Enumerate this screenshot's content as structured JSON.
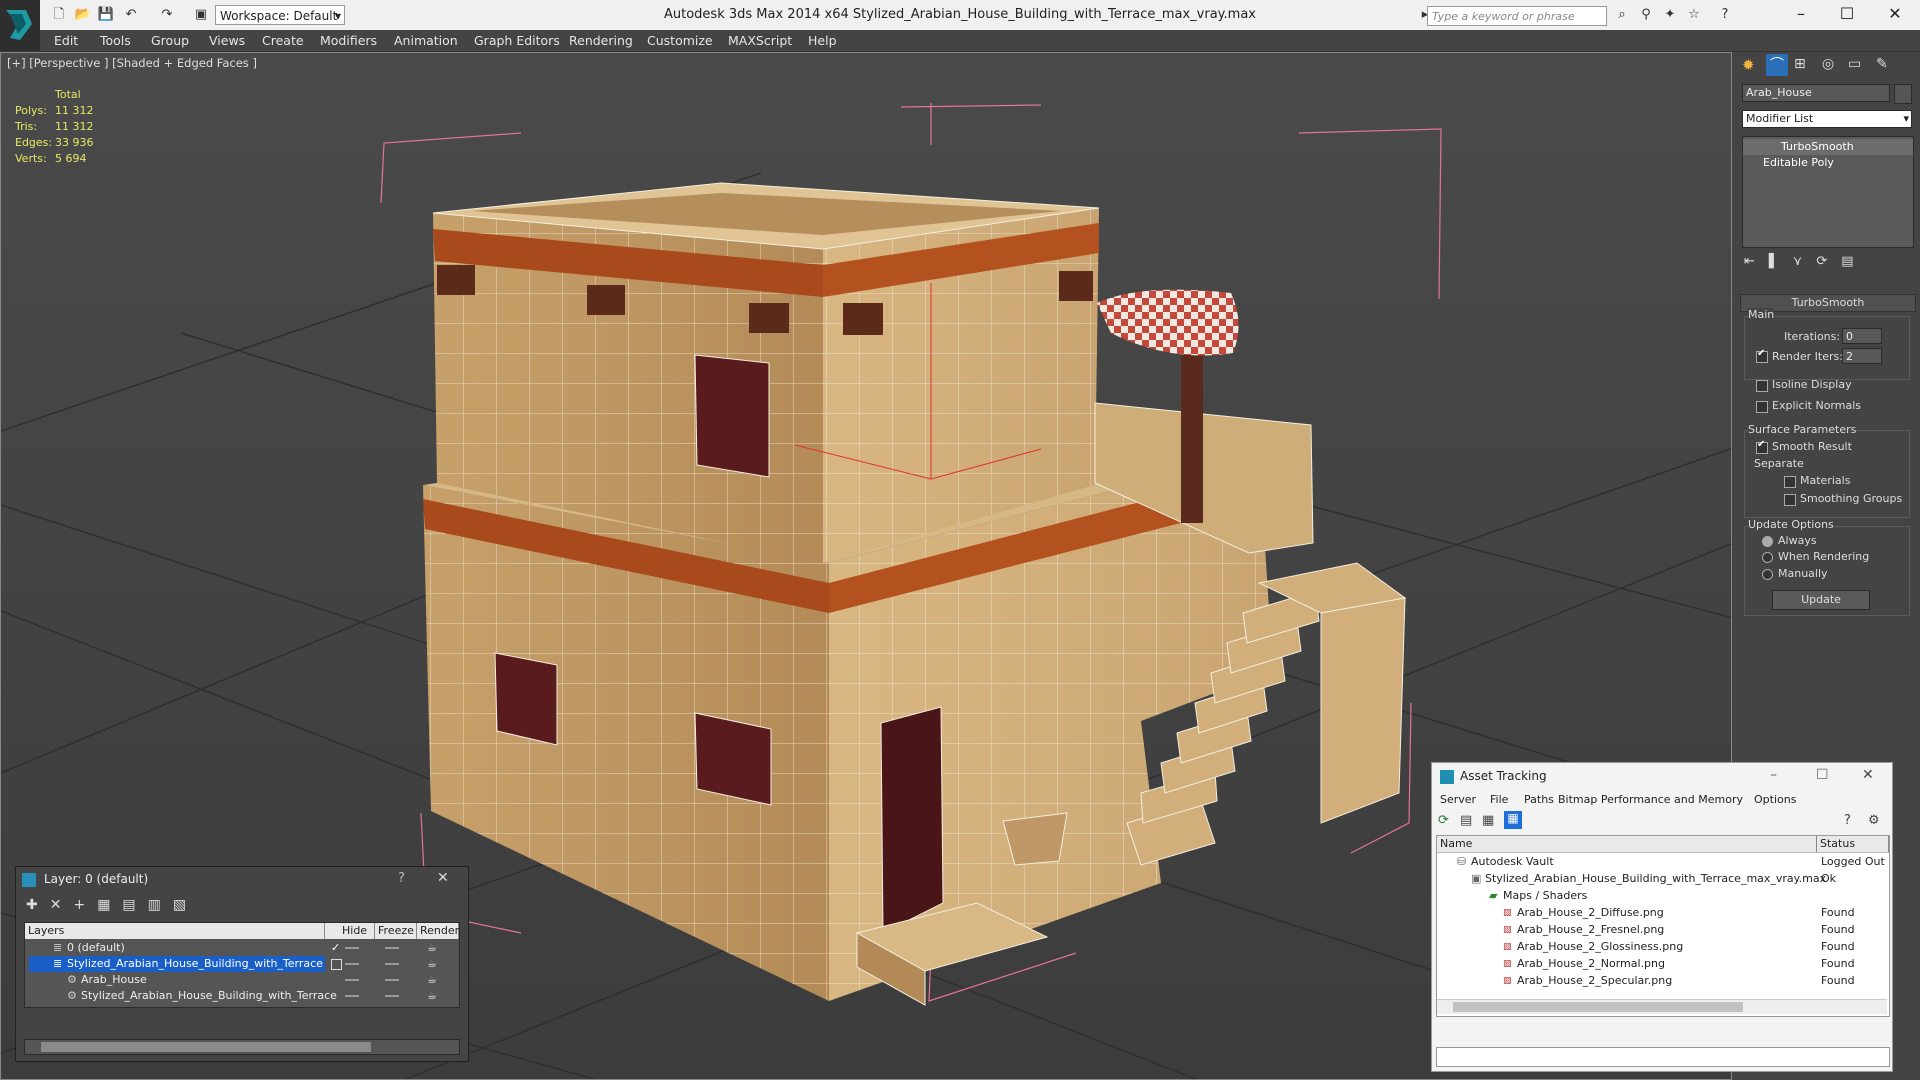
{
  "titlebar": {
    "title": "Autodesk 3ds Max  2014 x64      Stylized_Arabian_House_Building_with_Terrace_max_vray.max",
    "workspace": "Workspace: Default",
    "search_placeholder": "Type a keyword or phrase",
    "minimize": "–",
    "maximize": "☐",
    "close": "✕"
  },
  "menubar": {
    "items": [
      "Edit",
      "Tools",
      "Group",
      "Views",
      "Create",
      "Modifiers",
      "Animation",
      "Graph Editors",
      "Rendering",
      "Customize",
      "MAXScript",
      "Help"
    ]
  },
  "viewport": {
    "label": "[+] [Perspective ] [Shaded + Edged Faces ]",
    "stats": {
      "header": "Total",
      "rows": [
        {
          "key": "Polys:",
          "value": "11 312"
        },
        {
          "key": "Tris:",
          "value": "11 312"
        },
        {
          "key": "Edges:",
          "value": "33 936"
        },
        {
          "key": "Verts:",
          "value": "5 694"
        }
      ]
    }
  },
  "command_panel": {
    "object_name": "Arab_House",
    "modifier_list": "Modifier List",
    "stack": [
      "TurboSmooth",
      "Editable Poly"
    ],
    "rollout_title": "TurboSmooth",
    "main_label": "Main",
    "iterations_label": "Iterations:",
    "iterations_value": "0",
    "render_iters_label": "Render Iters:",
    "render_iters_value": "2",
    "isoline": "Isoline Display",
    "explicit": "Explicit Normals",
    "surface_params": "Surface Parameters",
    "smooth_result": "Smooth Result",
    "separate": "Separate",
    "materials": "Materials",
    "smoothing_groups": "Smoothing Groups",
    "update_options": "Update Options",
    "always": "Always",
    "when_rendering": "When Rendering",
    "manually": "Manually",
    "update_button": "Update"
  },
  "layer_dialog": {
    "title": "Layer: 0 (default)",
    "help": "?",
    "close": "✕",
    "columns": [
      "Layers",
      "Hide",
      "Freeze",
      "Render"
    ],
    "rows": [
      {
        "name": "0 (default)",
        "indent": 1,
        "selected": false
      },
      {
        "name": "Stylized_Arabian_House_Building_with_Terrace",
        "indent": 1,
        "selected": true
      },
      {
        "name": "Arab_House",
        "indent": 2,
        "selected": false
      },
      {
        "name": "Stylized_Arabian_House_Building_with_Terrace",
        "indent": 2,
        "selected": false
      }
    ]
  },
  "asset_dialog": {
    "title": "Asset Tracking",
    "menu": [
      "Server",
      "File",
      "Paths",
      "Bitmap Performance and Memory",
      "Options"
    ],
    "columns": [
      "Name",
      "Status"
    ],
    "rows": [
      {
        "name": "Autodesk Vault",
        "status": "Logged Out",
        "indent": 1
      },
      {
        "name": "Stylized_Arabian_House_Building_with_Terrace_max_vray.max",
        "status": "Ok",
        "indent": 2
      },
      {
        "name": "Maps / Shaders",
        "status": "",
        "indent": 3
      },
      {
        "name": "Arab_House_2_Diffuse.png",
        "status": "Found",
        "indent": 4
      },
      {
        "name": "Arab_House_2_Fresnel.png",
        "status": "Found",
        "indent": 4
      },
      {
        "name": "Arab_House_2_Glossiness.png",
        "status": "Found",
        "indent": 4
      },
      {
        "name": "Arab_House_2_Normal.png",
        "status": "Found",
        "indent": 4
      },
      {
        "name": "Arab_House_2_Specular.png",
        "status": "Found",
        "indent": 4
      }
    ]
  },
  "colors": {
    "accent": "#1e6fd9",
    "stats_text": "#e8e866",
    "selection_bg": "#1a5fc7"
  }
}
